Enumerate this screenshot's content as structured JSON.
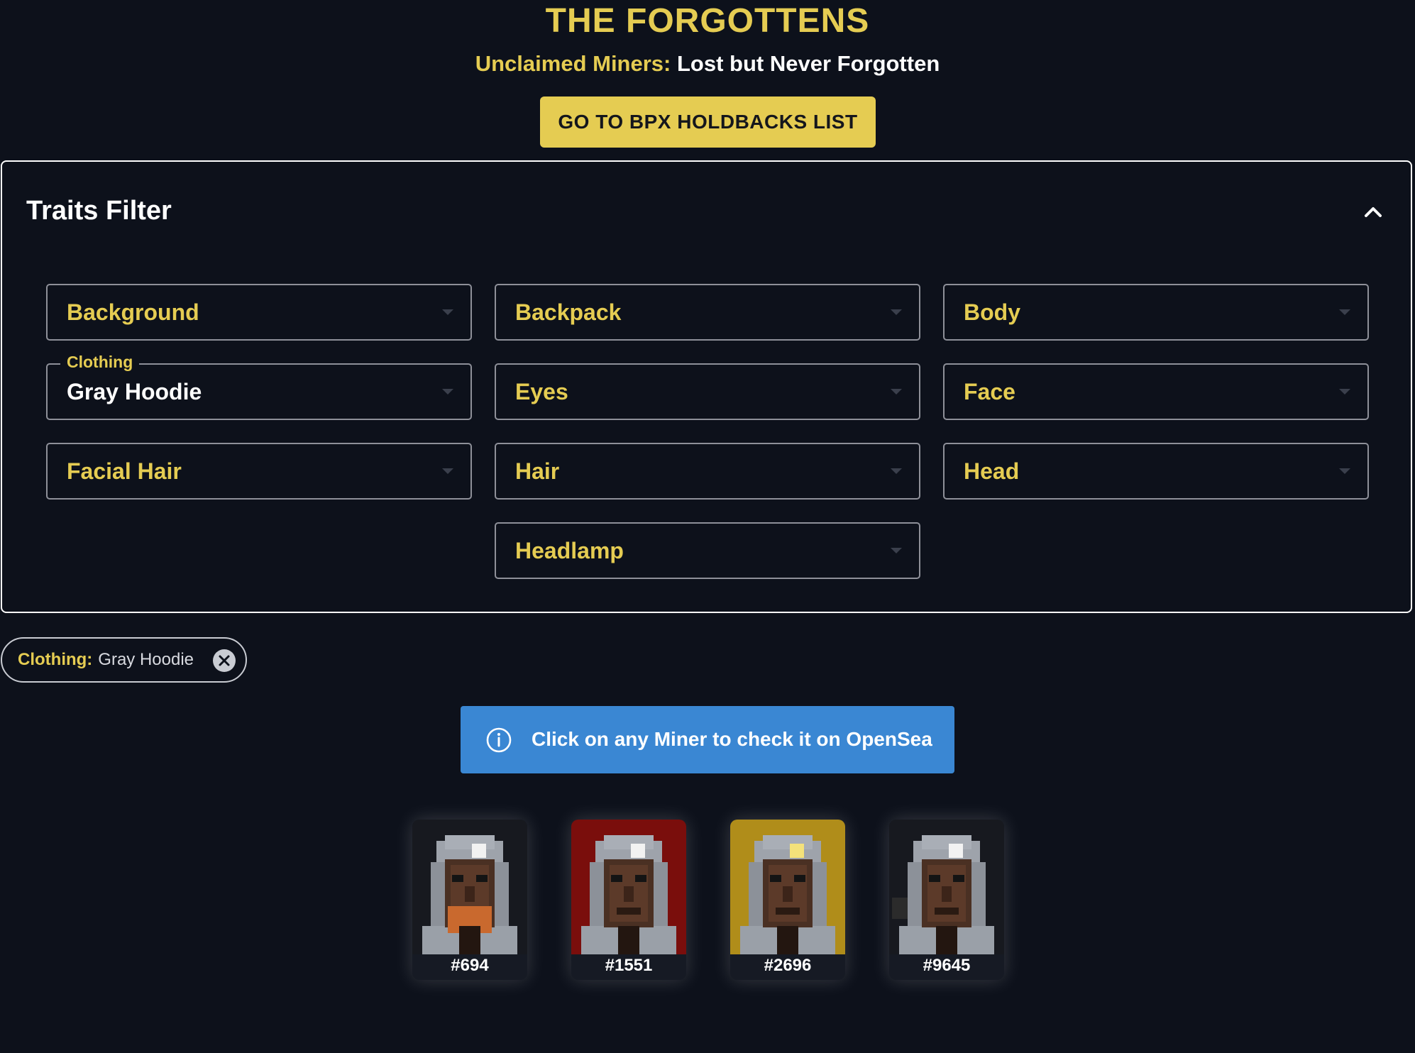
{
  "header": {
    "title": "THE FORGOTTENS",
    "subtitle_prefix": "Unclaimed Miners:",
    "subtitle_rest": "Lost but Never Forgotten",
    "holdbacks_button": "GO TO BPX HOLDBACKS LIST"
  },
  "filters": {
    "title": "Traits Filter",
    "collapse_icon": "chevron-up-icon",
    "fields": [
      {
        "label": "Background",
        "value": ""
      },
      {
        "label": "Backpack",
        "value": ""
      },
      {
        "label": "Body",
        "value": ""
      },
      {
        "label": "Clothing",
        "value": "Gray Hoodie"
      },
      {
        "label": "Eyes",
        "value": ""
      },
      {
        "label": "Face",
        "value": ""
      },
      {
        "label": "Facial Hair",
        "value": ""
      },
      {
        "label": "Hair",
        "value": ""
      },
      {
        "label": "Head",
        "value": ""
      },
      {
        "label": "Headlamp",
        "value": ""
      }
    ]
  },
  "active_filter": {
    "key": "Clothing:",
    "value": "Gray Hoodie",
    "close_icon": "close-circle-icon"
  },
  "info": {
    "icon": "info-icon",
    "text": "Click on any Miner to check it on OpenSea"
  },
  "miners": [
    {
      "id": "#694",
      "bg": "#17191f"
    },
    {
      "id": "#1551",
      "bg": "#7a0e0c"
    },
    {
      "id": "#2696",
      "bg": "#b08d1a"
    },
    {
      "id": "#9645",
      "bg": "#17191f"
    }
  ],
  "colors": {
    "accent": "#e5cc52",
    "background": "#0d111b",
    "info_blue": "#3a87d3"
  }
}
